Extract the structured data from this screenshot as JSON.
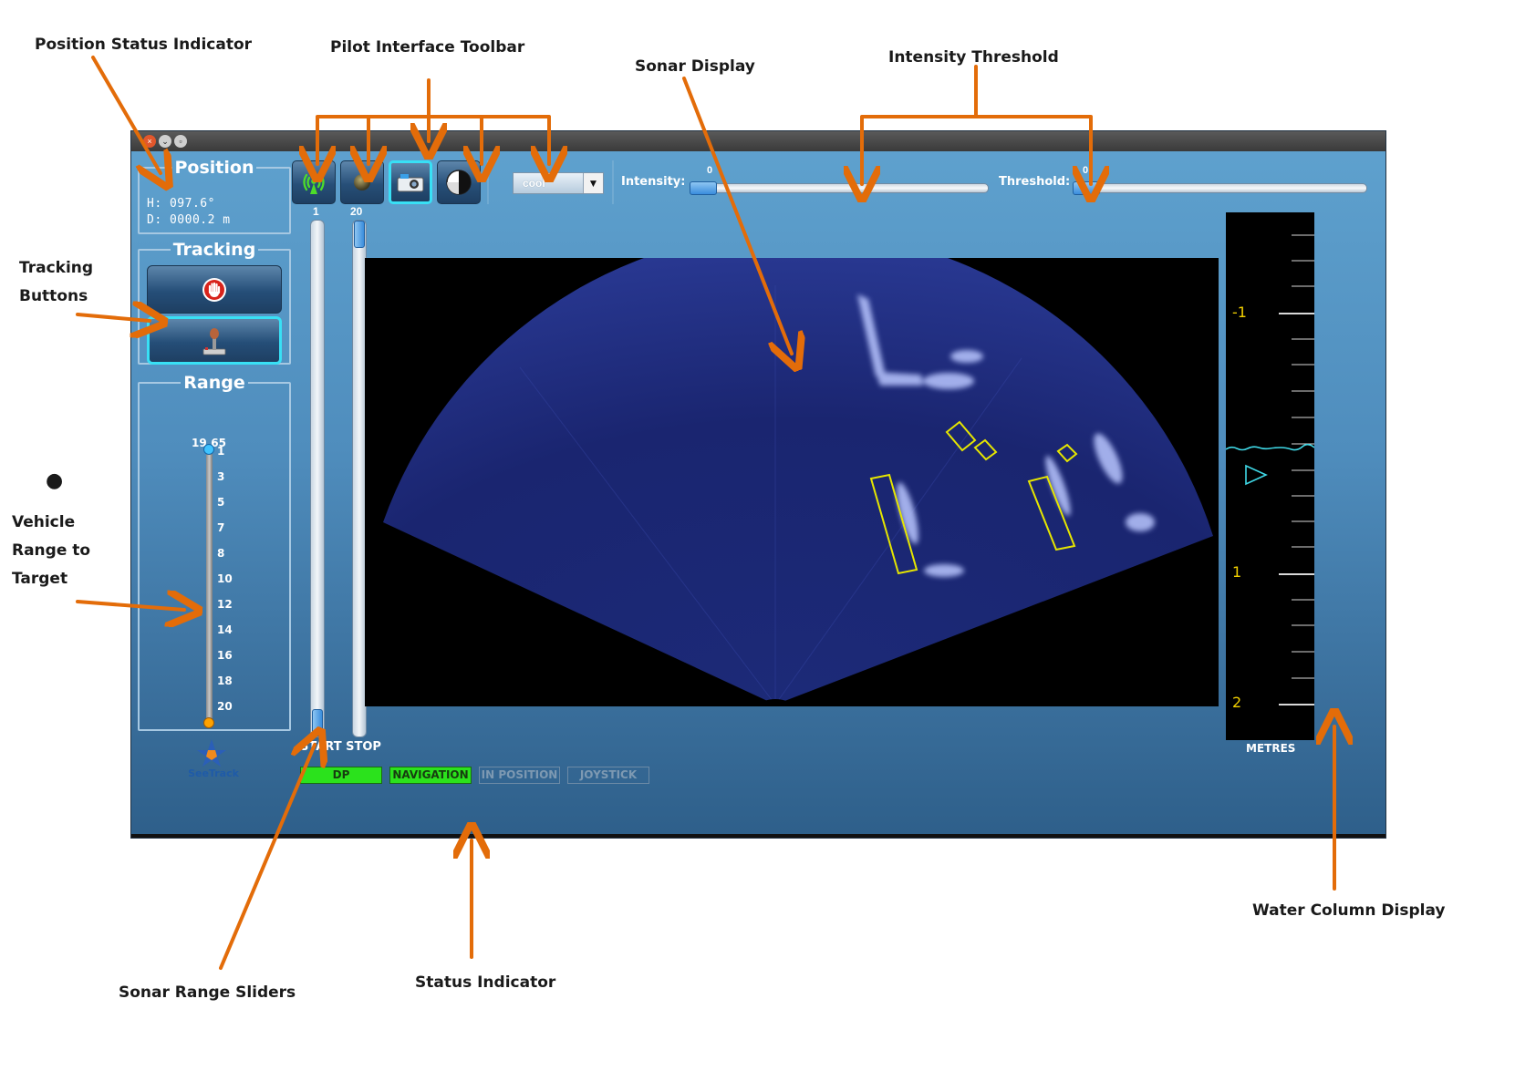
{
  "annotations": {
    "position_status": "Position Status Indicator",
    "pilot_toolbar": "Pilot Interface Toolbar",
    "sonar_display": "Sonar Display",
    "intensity_threshold": "Intensity Threshold",
    "tracking_line1": "Tracking",
    "tracking_line2": "Buttons",
    "vehicle_line1": "Vehicle",
    "vehicle_line2": "Range to",
    "vehicle_line3": "Target",
    "water_column": "Water Column Display",
    "sonar_range_sliders": "Sonar Range Sliders",
    "status_indicator": "Status Indicator"
  },
  "position": {
    "legend": "Position",
    "heading": "H:  097.6°",
    "distance": "D:   0000.2 m"
  },
  "tracking": {
    "legend": "Tracking",
    "stop_icon": "hand-stop-icon",
    "joystick_icon": "joystick-icon"
  },
  "range": {
    "legend": "Range",
    "current": "19.65",
    "ticks": [
      "1",
      "3",
      "5",
      "7",
      "8",
      "10",
      "12",
      "14",
      "16",
      "18",
      "20"
    ],
    "marker_value": 19.65
  },
  "logo": {
    "text": "SeeTrack"
  },
  "toolbar": {
    "buttons": [
      "wireless-icon",
      "sphere-icon",
      "camera-icon",
      "contrast-icon"
    ],
    "colormap": "cool",
    "intensity_label": "Intensity:",
    "intensity_value": "0",
    "threshold_label": "Threshold:",
    "threshold_value": "0"
  },
  "sliders": {
    "start_value": "1",
    "stop_value": "20",
    "labels": "START STOP"
  },
  "water_column": {
    "labels": [
      "-1",
      "1",
      "2"
    ],
    "units": "METRES"
  },
  "status": {
    "items": [
      "DP",
      "NAVIGATION",
      "IN POSITION",
      "JOYSTICK"
    ],
    "active_color": "#2be21c"
  },
  "colors": {
    "arrow": "#e36c09",
    "target_box": "#e6e600",
    "sonar_blue": "#2b3a9a"
  }
}
